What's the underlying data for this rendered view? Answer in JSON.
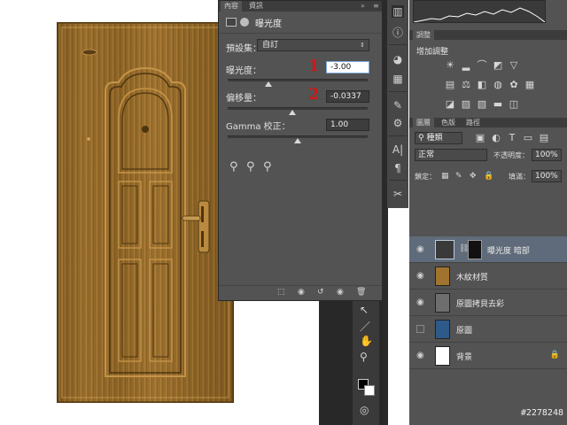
{
  "properties_panel": {
    "tabs": [
      "內容",
      "資訊"
    ],
    "header_title": "曝光度",
    "preset_label": "預設集：",
    "preset_value": "自訂",
    "exposure_label": "曝光度：",
    "exposure_value": "-3.00",
    "exposure_slider_level": 0.29,
    "offset_label": "偏移量：",
    "offset_value": "-0.0337",
    "offset_slider_level": 0.46,
    "gamma_label": "Gamma 校正：",
    "gamma_value": "1.00",
    "gamma_slider_level": 0.5,
    "annotation_1": "1",
    "annotation_2": "2",
    "tab_icons": [
      "close-icon",
      "menu-icon"
    ],
    "bottom_icons": [
      "clip-to-layer-icon",
      "view-previous-icon",
      "reset-icon",
      "visibility-icon",
      "delete-icon"
    ]
  },
  "right_panels": {
    "adjustments_tabs": [
      "調整"
    ],
    "adjustments_title": "增加調整",
    "layers_tabs": [
      "圖層",
      "色版",
      "路徑"
    ],
    "filter_label": "種類",
    "blend_mode": "正常",
    "opacity_label": "不透明度：",
    "opacity_value": "100%",
    "lock_label": "鎖定：",
    "fill_label": "填滿：",
    "fill_value": "100%",
    "layers": [
      {
        "name": "曝光度 暗部",
        "selected": true,
        "visible": true,
        "type": "adjustment"
      },
      {
        "name": "木紋材質",
        "selected": false,
        "visible": true,
        "type": "wood"
      },
      {
        "name": "原圖拷貝去彩",
        "selected": false,
        "visible": true,
        "type": "gray"
      },
      {
        "name": "原圖",
        "selected": false,
        "visible": false,
        "type": "blue"
      },
      {
        "name": "背景",
        "selected": false,
        "visible": true,
        "type": "white",
        "locked": true
      }
    ]
  },
  "watermark": "#2278248",
  "colors": {
    "panel_bg": "#535353",
    "selected_layer": "#5f6b7a",
    "annotation_red": "#d01818",
    "wood": "#a0732f"
  }
}
